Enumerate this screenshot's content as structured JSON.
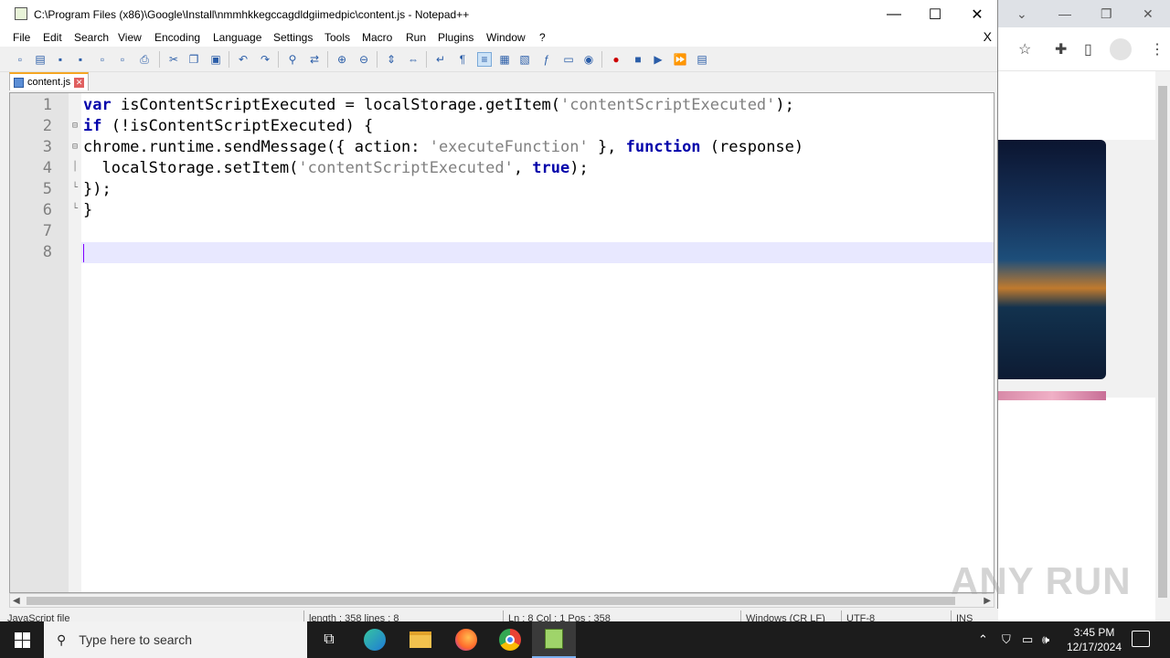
{
  "window": {
    "title": "C:\\Program Files (x86)\\Google\\Install\\nmmhkkegccagdldgiimedpic\\content.js - Notepad++",
    "minimize": "—",
    "maximize": "☐",
    "close": "✕"
  },
  "menu": [
    "File",
    "Edit",
    "Search",
    "View",
    "Encoding",
    "Language",
    "Settings",
    "Tools",
    "Macro",
    "Run",
    "Plugins",
    "Window",
    "?"
  ],
  "menu_close": "X",
  "tab": {
    "label": "content.js"
  },
  "editor": {
    "line_numbers": [
      "1",
      "2",
      "3",
      "4",
      "5",
      "6",
      "7",
      "8"
    ],
    "lines": [
      {
        "kw1": "var",
        "rest": " isContentScriptExecuted = localStorage.getItem(",
        "str": "'contentScriptExecuted'",
        "tail": ");"
      },
      {
        "kw1": "if",
        "rest": " (!isContentScriptExecuted) {"
      },
      {
        "plain": "chrome.runtime.sendMessage({ action: ",
        "str": "'executeFunction'",
        "mid": " }, ",
        "kw2": "function",
        "tail": " (response)"
      },
      {
        "plain": "  localStorage.setItem(",
        "str": "'contentScriptExecuted'",
        "mid": ", ",
        "kw2": "true",
        "tail": ");"
      },
      {
        "plain": "});"
      },
      {
        "plain": "}"
      },
      {
        "plain": ""
      },
      {
        "plain": ""
      }
    ]
  },
  "status": {
    "lang": "JavaScript file",
    "length": "length : 358   lines : 8",
    "pos": "Ln : 8   Col : 1   Pos : 358",
    "eol": "Windows (CR LF)",
    "enc": "UTF-8",
    "mode": "INS"
  },
  "watermark": "ANY RUN",
  "taskbar": {
    "search_placeholder": "Type here to search",
    "time": "3:45 PM",
    "date": "12/17/2024"
  },
  "icons": [
    "search-icon",
    "task-view-icon",
    "edge-icon",
    "file-explorer-icon",
    "firefox-icon",
    "chrome-icon",
    "notepadpp-icon"
  ]
}
